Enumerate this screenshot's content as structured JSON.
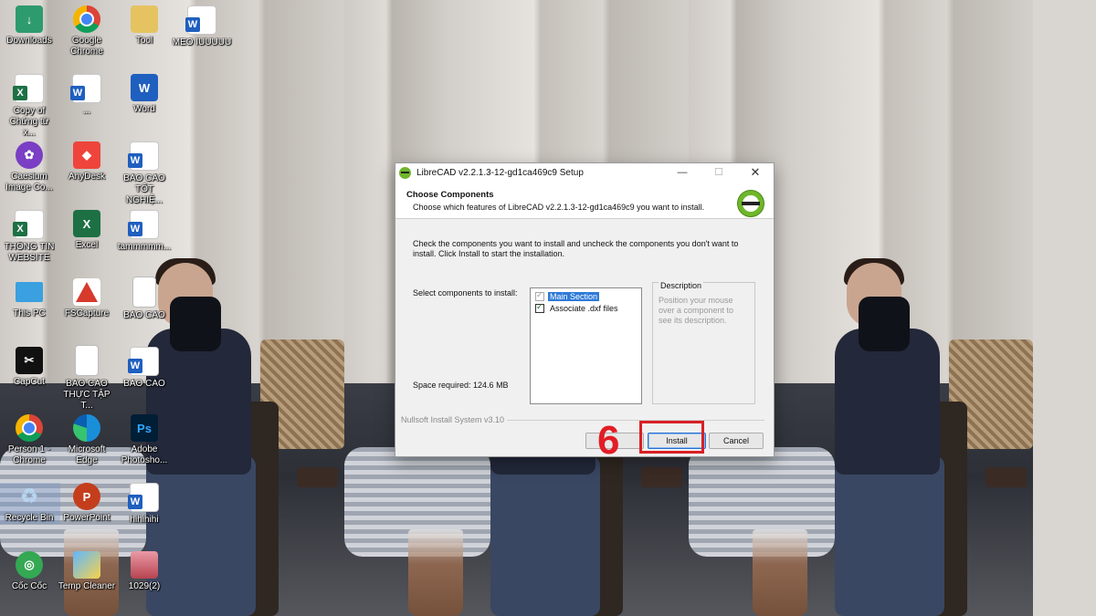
{
  "desktop": {
    "icons": [
      {
        "label": "Downloads",
        "icon": "downloads-folder-icon"
      },
      {
        "label": "Google Chrome",
        "icon": "chrome-icon"
      },
      {
        "label": "Tool",
        "icon": "folder-icon"
      },
      {
        "label": "MEO IUUUUU",
        "icon": "word-document-icon"
      },
      {
        "label": "Copy of Chứng từ x...",
        "icon": "excel-document-icon"
      },
      {
        "label": "...",
        "icon": "word-document-icon"
      },
      {
        "label": "Word",
        "icon": "word-app-icon"
      },
      {
        "label": "Caesium Image Co...",
        "icon": "caesium-icon"
      },
      {
        "label": "AnyDesk",
        "icon": "anydesk-icon"
      },
      {
        "label": "BÁO CÁO TỐT NGHIỆ...",
        "icon": "word-document-icon"
      },
      {
        "label": "THÔNG TIN WEBSITE",
        "icon": "excel-document-icon"
      },
      {
        "label": "Excel",
        "icon": "excel-app-icon"
      },
      {
        "label": "tammmmm...",
        "icon": "word-document-icon"
      },
      {
        "label": "This PC",
        "icon": "this-pc-icon"
      },
      {
        "label": "FSCapture",
        "icon": "fscapture-icon"
      },
      {
        "label": "BÁO CÁO",
        "icon": "document-page-icon"
      },
      {
        "label": "CapCut",
        "icon": "capcut-icon"
      },
      {
        "label": "BÁO CÁO THỰC TẬP T...",
        "icon": "document-page-icon"
      },
      {
        "label": "BÁO CÁO",
        "icon": "word-document-icon"
      },
      {
        "label": "Person 1 - Chrome",
        "icon": "chrome-profile-icon"
      },
      {
        "label": "Microsoft Edge",
        "icon": "edge-icon"
      },
      {
        "label": "Adobe Photosho...",
        "icon": "photoshop-icon"
      },
      {
        "label": "Recycle Bin",
        "icon": "recycle-bin-icon"
      },
      {
        "label": "PowerPoint",
        "icon": "powerpoint-icon"
      },
      {
        "label": "hihihihi",
        "icon": "word-document-icon"
      },
      {
        "label": "Cốc Cốc",
        "icon": "coccoc-icon"
      },
      {
        "label": "Temp Cleaner",
        "icon": "temp-cleaner-icon"
      },
      {
        "label": "1029(2)",
        "icon": "photo-icon"
      }
    ]
  },
  "dialog": {
    "title": "LibreCAD v2.2.1.3-12-gd1ca469c9 Setup",
    "controls": {
      "minimize": "—",
      "maximize": "☐",
      "close": "✕"
    },
    "header_title": "Choose Components",
    "header_subtitle": "Choose which features of LibreCAD v2.2.1.3-12-gd1ca469c9 you want to install.",
    "intro": "Check the components you want to install and uncheck the components you don't want to install. Click Install to start the installation.",
    "select_label": "Select components to install:",
    "components": [
      {
        "label": "Main Section",
        "checked": true,
        "disabled": true
      },
      {
        "label": "Associate .dxf files",
        "checked": true,
        "disabled": false
      }
    ],
    "space_required": "Space required: 124.6 MB",
    "description_title": "Description",
    "description_text": "Position your mouse over a component to see its description.",
    "branding": "Nullsoft Install System v3.10",
    "buttons": {
      "back": "",
      "install": "Install",
      "cancel": "Cancel"
    }
  },
  "annotation": {
    "step_number": "6",
    "color": "#e21d26"
  }
}
